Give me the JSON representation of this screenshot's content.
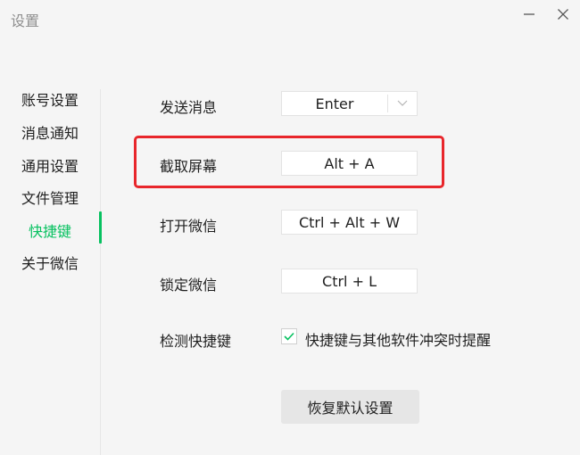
{
  "window": {
    "title": "设置",
    "minimize_icon": "minimize-icon",
    "close_icon": "close-icon"
  },
  "sidebar": {
    "items": [
      {
        "label": "账号设置",
        "active": false
      },
      {
        "label": "消息通知",
        "active": false
      },
      {
        "label": "通用设置",
        "active": false
      },
      {
        "label": "文件管理",
        "active": false
      },
      {
        "label": "快捷键",
        "active": true
      },
      {
        "label": "关于微信",
        "active": false
      }
    ],
    "active_color": "#07c160"
  },
  "shortcuts": {
    "send_message": {
      "label": "发送消息",
      "value": "Enter",
      "icon": "chevron-down-icon"
    },
    "screenshot": {
      "label": "截取屏幕",
      "value": "Alt + A"
    },
    "open_wechat": {
      "label": "打开微信",
      "value": "Ctrl + Alt + W"
    },
    "lock_wechat": {
      "label": "锁定微信",
      "value": "Ctrl + L"
    },
    "detect": {
      "label": "检测快捷键",
      "checkbox_label": "快捷键与其他软件冲突时提醒",
      "checked": true
    }
  },
  "reset_button": {
    "label": "恢复默认设置"
  },
  "annotation": {
    "highlight_color": "#e8262b"
  }
}
